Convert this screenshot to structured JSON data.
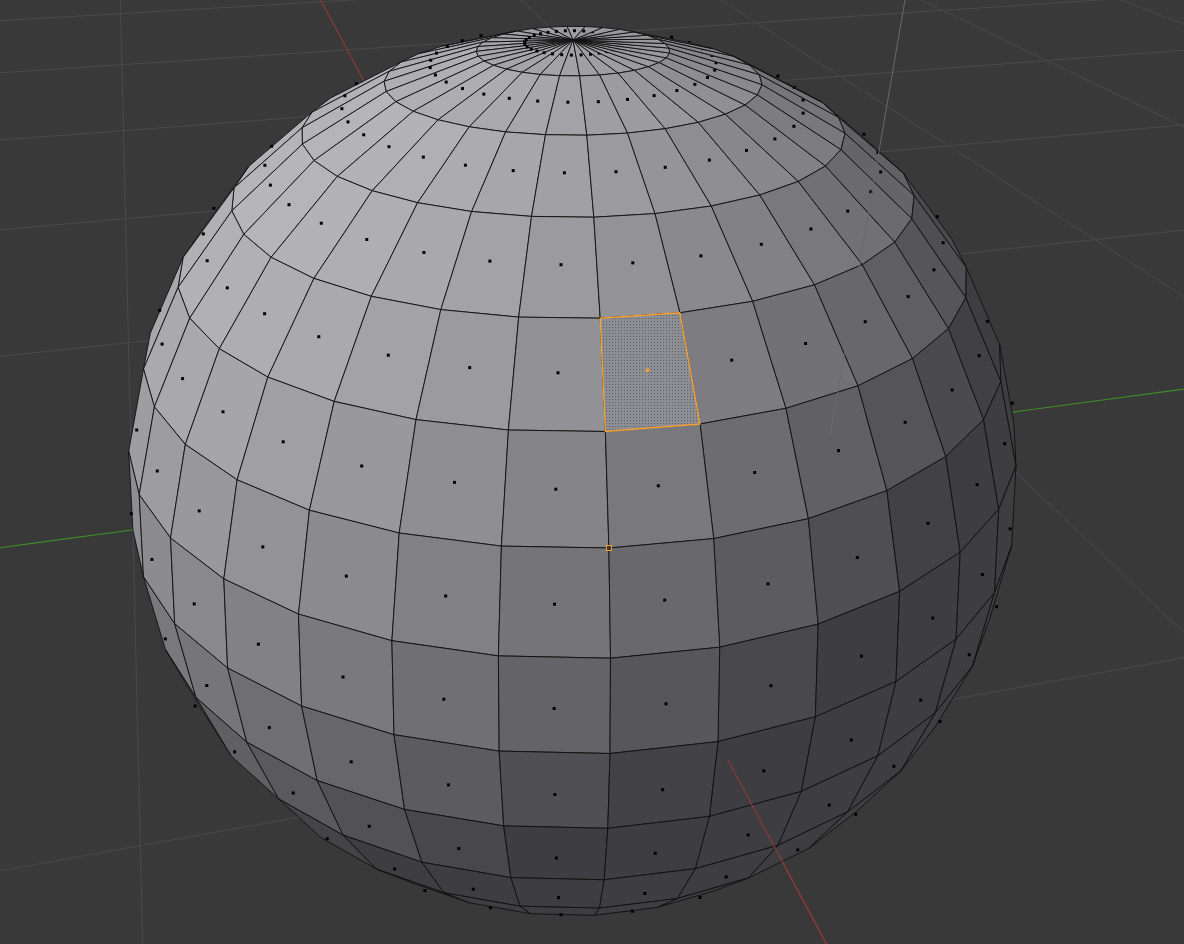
{
  "viewport": {
    "face_selected": true
  }
}
